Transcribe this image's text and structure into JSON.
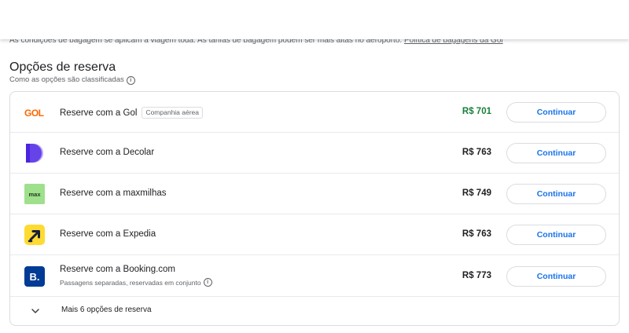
{
  "header": {
    "cut_text": "As condições de bagagem se aplicam à viagem toda. As tarifas de bagagem podem ser mais altas no aeroporto.",
    "cut_link": "Política de bagagens da Gol"
  },
  "section": {
    "title": "Opções de reserva",
    "subtitle": "Como as opções são classificadas"
  },
  "options": [
    {
      "label": "Reserve com a Gol",
      "badge": "Companhia aérea",
      "price": "R$ 701",
      "button": "Continuar",
      "logo_text": "GOL",
      "logo_color": "#ff6600"
    },
    {
      "label": "Reserve com a Decolar",
      "price": "R$ 763",
      "button": "Continuar",
      "logo_color": "#4b24e0"
    },
    {
      "label": "Reserve com a maxmilhas",
      "price": "R$ 749",
      "button": "Continuar",
      "logo_text": "max",
      "logo_color": "#9fe08c"
    },
    {
      "label": "Reserve com a Expedia",
      "price": "R$ 763",
      "button": "Continuar",
      "logo_color": "#fddb32"
    },
    {
      "label": "Reserve com a Booking.com",
      "note": "Passagens separadas, reservadas em conjunto",
      "price": "R$ 773",
      "button": "Continuar",
      "logo_text": "B.",
      "logo_color": "#003b95"
    }
  ],
  "more": {
    "label": "Mais 6 opções de reserva"
  },
  "colors": {
    "accent": "#1a73e8",
    "best_price": "#188038"
  }
}
